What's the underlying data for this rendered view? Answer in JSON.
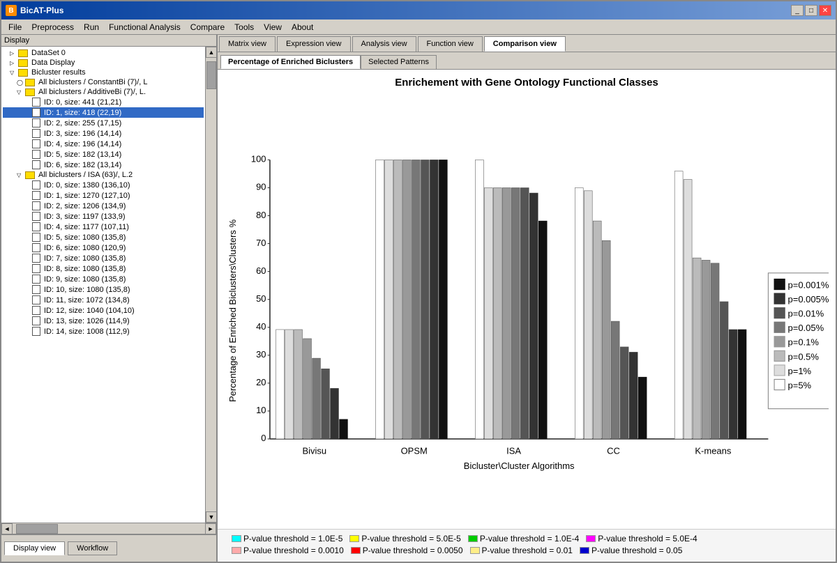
{
  "window": {
    "title": "BicAT-Plus"
  },
  "menubar": {
    "items": [
      "File",
      "Preprocess",
      "Run",
      "Functional Analysis",
      "Compare",
      "Tools",
      "View",
      "About"
    ]
  },
  "tabs": {
    "main": [
      "Matrix view",
      "Expression view",
      "Analysis view",
      "Function view",
      "Comparison view"
    ],
    "active_main": "Comparison view",
    "sub": [
      "Percentage of Enriched Biclusters",
      "Selected Patterns"
    ],
    "active_sub": "Percentage of Enriched Biclusters"
  },
  "chart": {
    "title": "Enrichement with Gene Ontology Functional Classes",
    "y_label": "Percentage of Enriched Biclusters\\Clusters %",
    "x_label": "Bicluster\\Cluster Algorithms",
    "x_categories": [
      "Bivisu",
      "OPSM",
      "ISA",
      "CC",
      "K-means"
    ],
    "y_ticks": [
      0,
      10,
      20,
      30,
      40,
      50,
      60,
      70,
      80,
      90,
      100
    ],
    "legend": [
      {
        "label": "p=0.001%",
        "color": "#111111"
      },
      {
        "label": "p=0.005%",
        "color": "#333333"
      },
      {
        "label": "p=0.01%",
        "color": "#555555"
      },
      {
        "label": "p=0.05%",
        "color": "#777777"
      },
      {
        "label": "p=0.1%",
        "color": "#999999"
      },
      {
        "label": "p=0.5%",
        "color": "#bbbbbb"
      },
      {
        "label": "p=1%",
        "color": "#dddddd"
      },
      {
        "label": "p=5%",
        "color": "#ffffff"
      }
    ],
    "data": {
      "Bivisu": [
        7,
        18,
        25,
        29,
        36,
        39,
        39,
        39
      ],
      "OPSM": [
        100,
        100,
        100,
        100,
        100,
        100,
        100,
        100
      ],
      "ISA": [
        78,
        88,
        90,
        90,
        90,
        90,
        90,
        100
      ],
      "CC": [
        22,
        31,
        33,
        42,
        71,
        78,
        89,
        90
      ],
      "Kmeans": [
        39,
        39,
        49,
        63,
        64,
        65,
        93,
        96
      ]
    }
  },
  "legend_bottom": [
    {
      "label": "P-value threshold = 1.0E-5",
      "color": "#00ffff"
    },
    {
      "label": "P-value threshold = 5.0E-5",
      "color": "#ffff00"
    },
    {
      "label": "P-value threshold = 1.0E-4",
      "color": "#00cc00"
    },
    {
      "label": "P-value threshold = 5.0E-4",
      "color": "#ff00ff"
    },
    {
      "label": "P-value threshold = 0.0010",
      "color": "#ffaaaa"
    },
    {
      "label": "P-value threshold = 0.0050",
      "color": "#ff0000"
    },
    {
      "label": "P-value threshold = 0.01",
      "color": "#ffee88"
    },
    {
      "label": "P-value threshold = 0.05",
      "color": "#0000cc"
    }
  ],
  "left_panel": {
    "header": "Display",
    "tree": [
      {
        "level": 1,
        "type": "folder",
        "label": "DataSet 0",
        "arrow": "▷"
      },
      {
        "level": 1,
        "type": "folder",
        "label": "Data Display",
        "arrow": "▷"
      },
      {
        "level": 1,
        "type": "folder",
        "label": "Bicluster results",
        "arrow": "▽"
      },
      {
        "level": 2,
        "type": "folder",
        "label": "All biclusters / ConstantBi (7)/, L",
        "arrow": "◯"
      },
      {
        "level": 2,
        "type": "folder",
        "label": "All biclusters / AdditiveBi (7)/, L.",
        "arrow": "▽"
      },
      {
        "level": 3,
        "type": "file",
        "label": "ID: 0, size: 441 (21,21)"
      },
      {
        "level": 3,
        "type": "file",
        "label": "ID: 1, size: 418 (22,19)",
        "selected": true
      },
      {
        "level": 3,
        "type": "file",
        "label": "ID: 2, size: 255 (17,15)"
      },
      {
        "level": 3,
        "type": "file",
        "label": "ID: 3, size: 196 (14,14)"
      },
      {
        "level": 3,
        "type": "file",
        "label": "ID: 4, size: 196 (14,14)"
      },
      {
        "level": 3,
        "type": "file",
        "label": "ID: 5, size: 182 (13,14)"
      },
      {
        "level": 3,
        "type": "file",
        "label": "ID: 6, size: 182 (13,14)"
      },
      {
        "level": 2,
        "type": "folder",
        "label": "All biclusters / ISA (63)/, L.2",
        "arrow": "▽"
      },
      {
        "level": 3,
        "type": "file",
        "label": "ID: 0, size: 1380 (136,10)"
      },
      {
        "level": 3,
        "type": "file",
        "label": "ID: 1, size: 1270 (127,10)"
      },
      {
        "level": 3,
        "type": "file",
        "label": "ID: 2, size: 1206 (134,9)"
      },
      {
        "level": 3,
        "type": "file",
        "label": "ID: 3, size: 1197 (133,9)"
      },
      {
        "level": 3,
        "type": "file",
        "label": "ID: 4, size: 1177 (107,11)"
      },
      {
        "level": 3,
        "type": "file",
        "label": "ID: 5, size: 1080 (135,8)"
      },
      {
        "level": 3,
        "type": "file",
        "label": "ID: 6, size: 1080 (120,9)"
      },
      {
        "level": 3,
        "type": "file",
        "label": "ID: 7, size: 1080 (135,8)"
      },
      {
        "level": 3,
        "type": "file",
        "label": "ID: 8, size: 1080 (135,8)"
      },
      {
        "level": 3,
        "type": "file",
        "label": "ID: 9, size: 1080 (135,8)"
      },
      {
        "level": 3,
        "type": "file",
        "label": "ID: 10, size: 1080 (135,8)"
      },
      {
        "level": 3,
        "type": "file",
        "label": "ID: 11, size: 1072 (134,8)"
      },
      {
        "level": 3,
        "type": "file",
        "label": "ID: 12, size: 1040 (104,10)"
      },
      {
        "level": 3,
        "type": "file",
        "label": "ID: 13, size: 1026 (114,9)"
      },
      {
        "level": 3,
        "type": "file",
        "label": "ID: 14, size: 1008 (112,9)"
      }
    ],
    "bottom_tabs": [
      "Display view",
      "Workflow"
    ]
  }
}
